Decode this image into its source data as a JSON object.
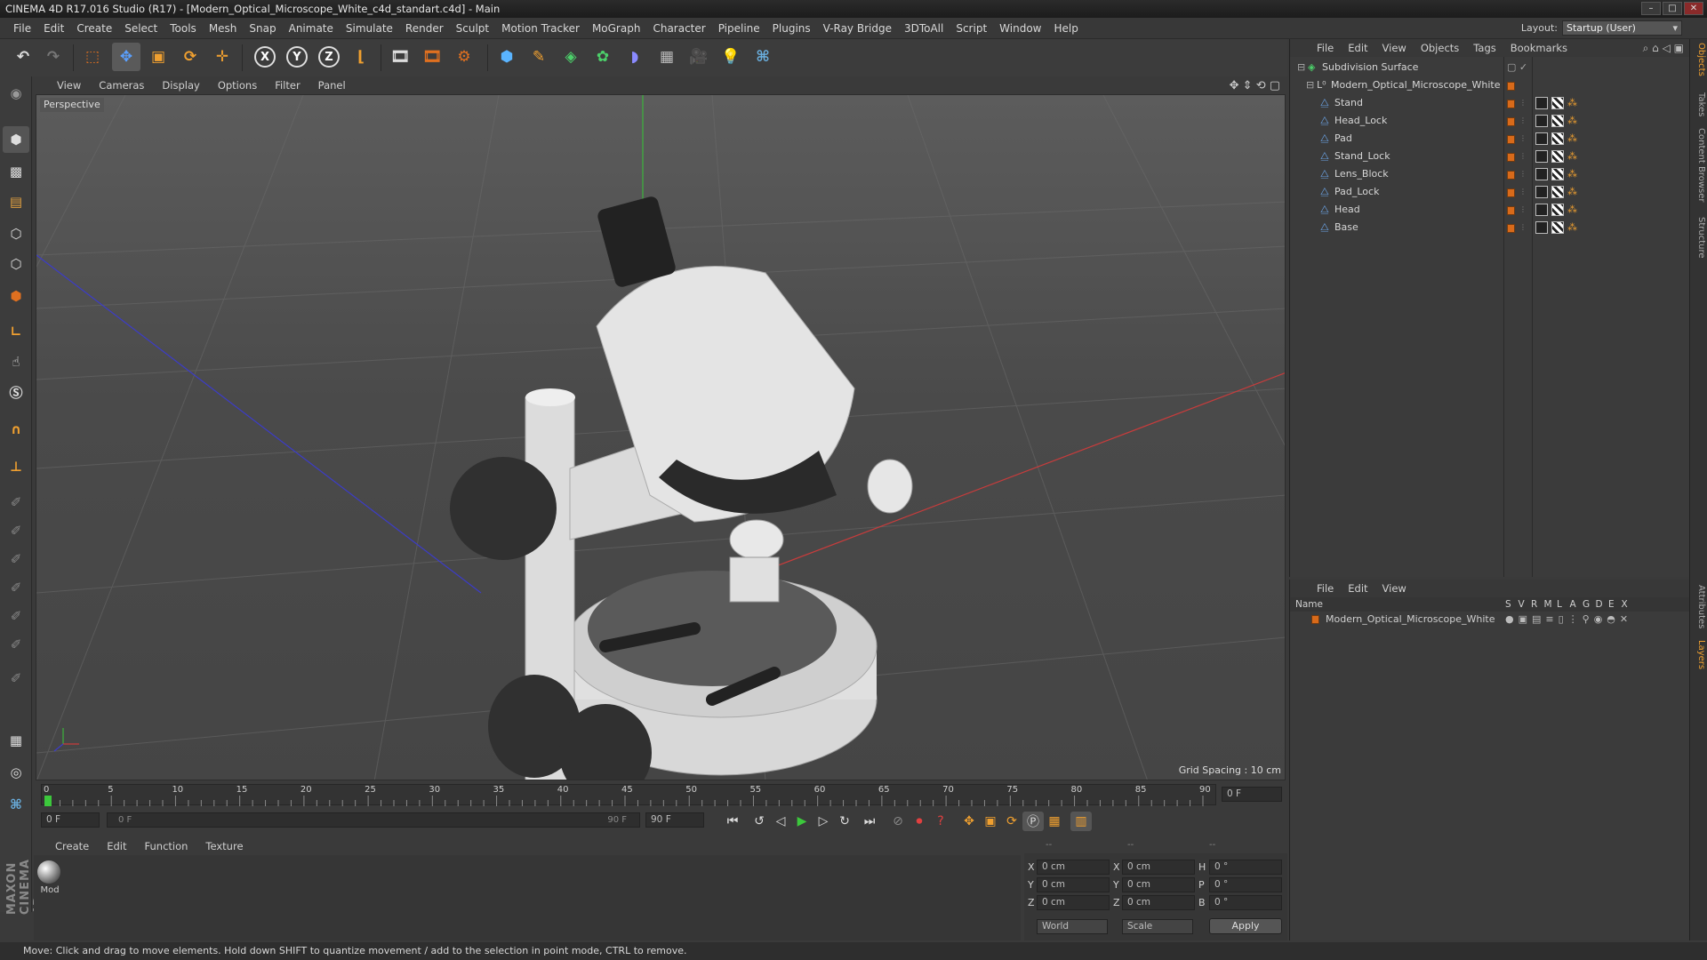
{
  "window": {
    "title": "CINEMA 4D R17.016 Studio (R17) - [Modern_Optical_Microscope_White_c4d_standart.c4d] - Main",
    "min": "–",
    "max": "□",
    "close": "✕"
  },
  "menubar": {
    "items": [
      "File",
      "Edit",
      "Create",
      "Select",
      "Tools",
      "Mesh",
      "Snap",
      "Animate",
      "Simulate",
      "Render",
      "Sculpt",
      "Motion Tracker",
      "MoGraph",
      "Character",
      "Pipeline",
      "Plugins",
      "V-Ray Bridge",
      "3DToAll",
      "Script",
      "Window",
      "Help"
    ],
    "layout_label": "Layout:",
    "layout_value": "Startup (User)"
  },
  "toolbar": {
    "icons": [
      "undo-icon",
      "redo-icon",
      "live-select-icon",
      "move-icon",
      "scale-icon",
      "rotate-icon",
      "transform-icon",
      "x-axis-icon",
      "y-axis-icon",
      "z-axis-icon",
      "coord-system-icon",
      "render-view-icon",
      "render-picture-viewer-icon",
      "edit-render-settings-icon",
      "cube-icon",
      "pen-icon",
      "subdivision-icon",
      "array-icon",
      "deformer-icon",
      "floor-icon",
      "camera-icon",
      "light-icon",
      "python-icon"
    ],
    "axis_x": "X",
    "axis_y": "Y",
    "axis_z": "Z"
  },
  "viewport": {
    "menu": [
      "View",
      "Cameras",
      "Display",
      "Options",
      "Filter",
      "Panel"
    ],
    "label": "Perspective",
    "grid_spacing": "Grid Spacing : 10 cm"
  },
  "timeline": {
    "ticks": [
      "0",
      "5",
      "10",
      "15",
      "20",
      "25",
      "30",
      "35",
      "40",
      "45",
      "50",
      "55",
      "60",
      "65",
      "70",
      "75",
      "80",
      "85",
      "90"
    ],
    "current_frame": "0 F"
  },
  "transport": {
    "start_field": "0 F",
    "range_start": "0 F",
    "range_end": "90 F",
    "end_field": "90 F"
  },
  "material_manager": {
    "menu": [
      "Create",
      "Edit",
      "Function",
      "Texture"
    ],
    "material_label": "Mod"
  },
  "coords": {
    "header_a": "--",
    "header_b": "--",
    "header_c": "--",
    "rows": [
      {
        "a": "X",
        "av": "0 cm",
        "b": "X",
        "bv": "0 cm",
        "c": "H",
        "cv": "0 °"
      },
      {
        "a": "Y",
        "av": "0 cm",
        "b": "Y",
        "bv": "0 cm",
        "c": "P",
        "cv": "0 °"
      },
      {
        "a": "Z",
        "av": "0 cm",
        "b": "Z",
        "bv": "0 cm",
        "c": "B",
        "cv": "0 °"
      }
    ],
    "mode": "World",
    "size_mode": "Scale",
    "apply": "Apply"
  },
  "status": {
    "text": "Move: Click and drag to move elements. Hold down SHIFT to quantize movement / add to the selection in point mode, CTRL to remove."
  },
  "object_manager": {
    "menu": [
      "File",
      "Edit",
      "View",
      "Objects",
      "Tags",
      "Bookmarks"
    ],
    "root": "Subdivision Surface",
    "group": "Modern_Optical_Microscope_White",
    "children": [
      "Stand",
      "Head_Lock",
      "Pad",
      "Stand_Lock",
      "Lens_Block",
      "Pad_Lock",
      "Head",
      "Base"
    ]
  },
  "layer_manager": {
    "menu": [
      "File",
      "Edit",
      "View"
    ],
    "col_name": "Name",
    "cols": [
      "S",
      "V",
      "R",
      "M",
      "L",
      "A",
      "G",
      "D",
      "E",
      "X"
    ],
    "layer": "Modern_Optical_Microscope_White"
  },
  "side_tabs": [
    "Objects",
    "Takes",
    "Content Browser",
    "Structure",
    "Attributes",
    "Layers"
  ],
  "brand": "MAXON CINEMA 4D",
  "colors": {
    "accent_orange": "#d86a1a",
    "axis_x": "#c83c3c",
    "axis_y": "#3cb43c",
    "axis_z": "#3c3cc8"
  }
}
